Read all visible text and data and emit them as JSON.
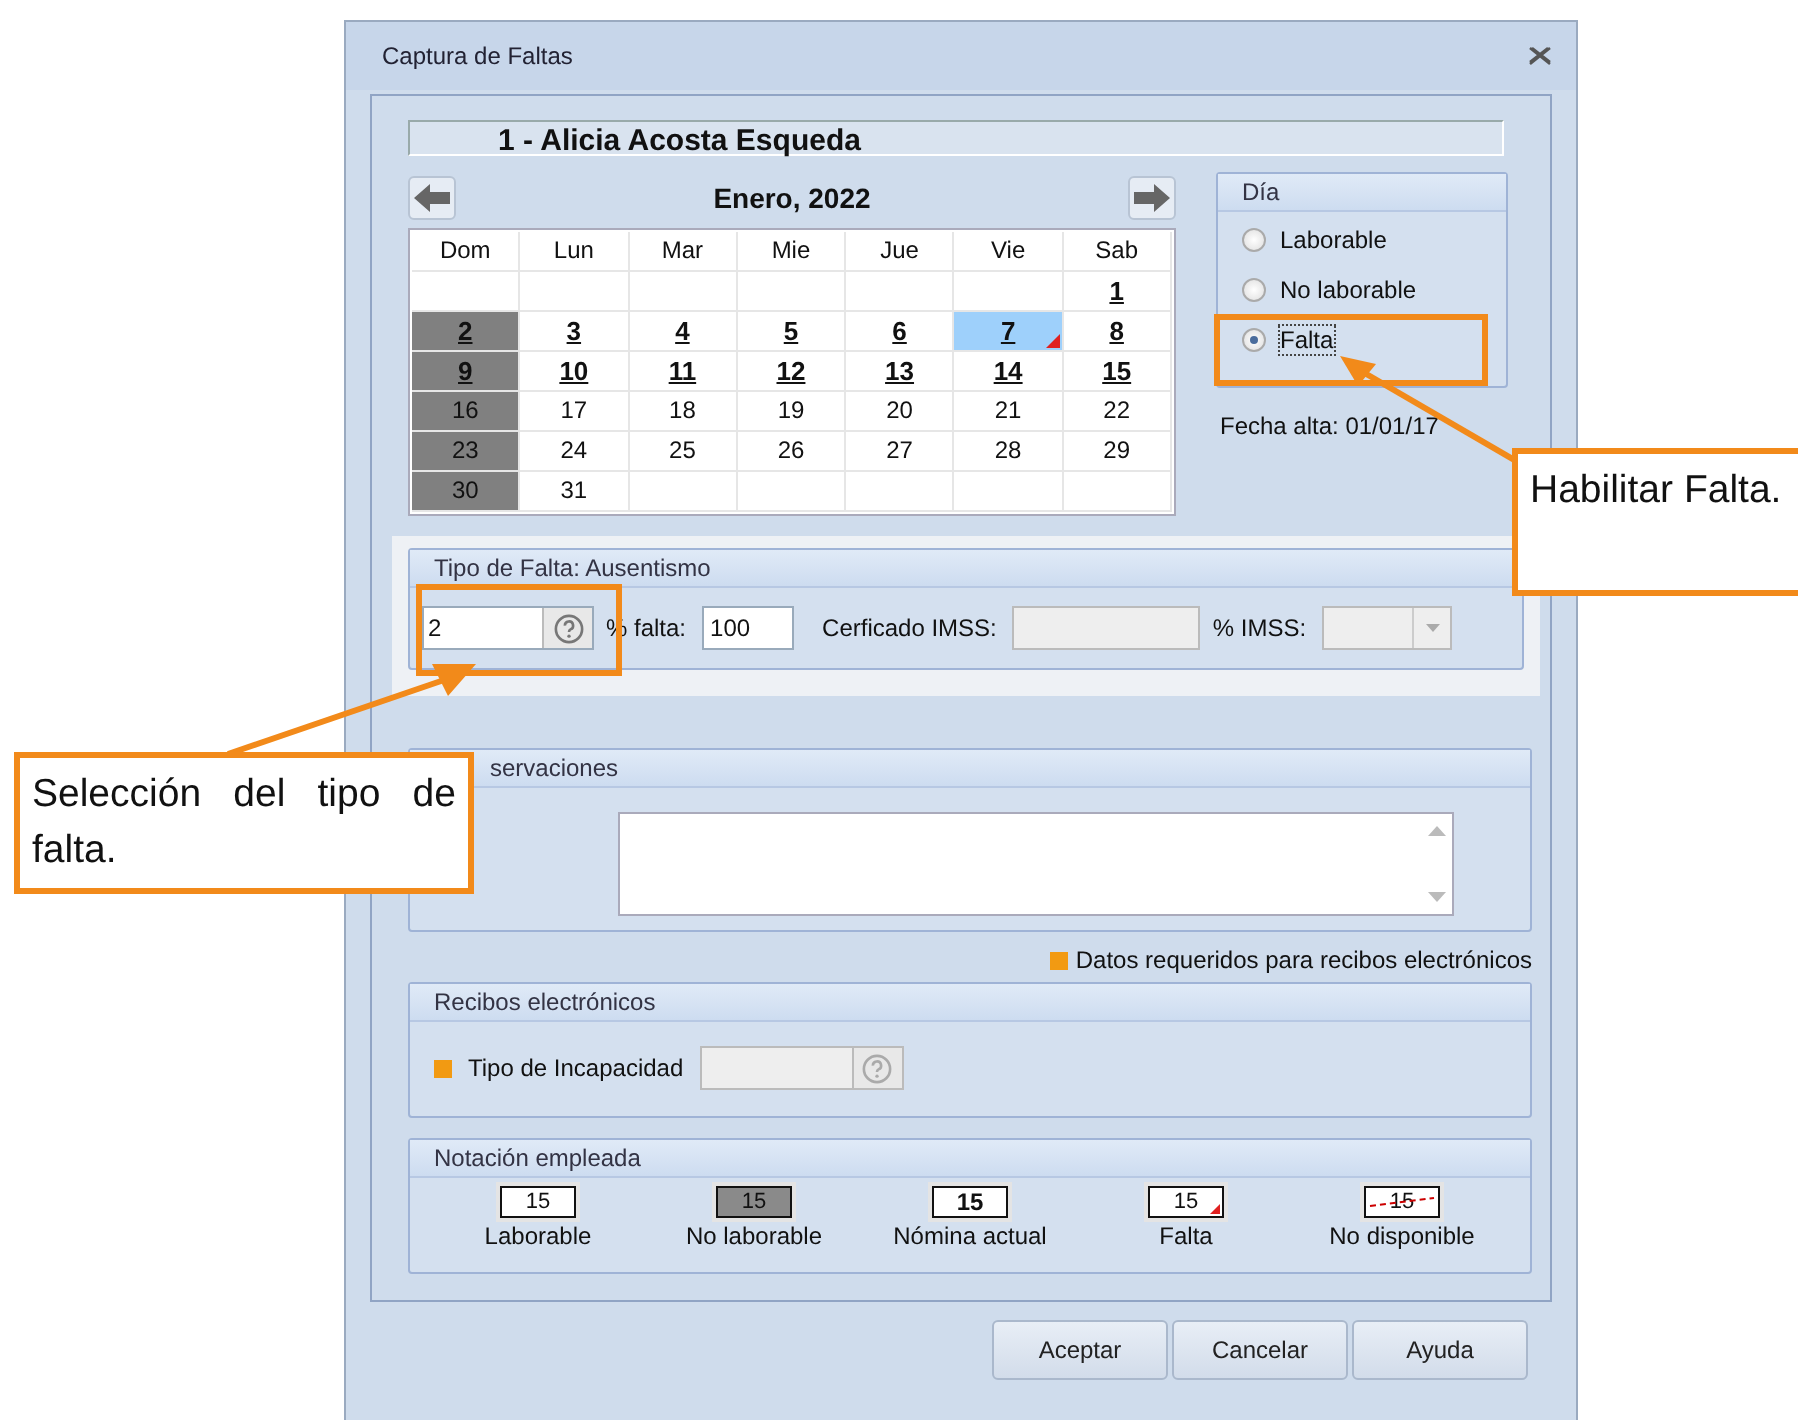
{
  "window": {
    "title": "Captura de Faltas"
  },
  "employee": "1 - Alicia Acosta Esqueda",
  "calendar": {
    "month": "Enero, 2022",
    "weekdays": [
      "Dom",
      "Lun",
      "Mar",
      "Mie",
      "Jue",
      "Vie",
      "Sab"
    ],
    "weeks": [
      [
        {
          "day": "1",
          "nonworking": false,
          "payroll": true,
          "selected": false,
          "falta": false
        }
      ],
      [
        {
          "day": "2",
          "nonworking": true,
          "payroll": true,
          "selected": false,
          "falta": false
        },
        {
          "day": "3",
          "nonworking": false,
          "payroll": true,
          "selected": false,
          "falta": false
        },
        {
          "day": "4",
          "nonworking": false,
          "payroll": true,
          "selected": false,
          "falta": false
        },
        {
          "day": "5",
          "nonworking": false,
          "payroll": true,
          "selected": false,
          "falta": false
        },
        {
          "day": "6",
          "nonworking": false,
          "payroll": true,
          "selected": false,
          "falta": false
        },
        {
          "day": "7",
          "nonworking": false,
          "payroll": true,
          "selected": true,
          "falta": true
        },
        {
          "day": "8",
          "nonworking": false,
          "payroll": true,
          "selected": false,
          "falta": false
        }
      ],
      [
        {
          "day": "9",
          "nonworking": true,
          "payroll": true,
          "selected": false,
          "falta": false
        },
        {
          "day": "10",
          "nonworking": false,
          "payroll": true,
          "selected": false,
          "falta": false
        },
        {
          "day": "11",
          "nonworking": false,
          "payroll": true,
          "selected": false,
          "falta": false
        },
        {
          "day": "12",
          "nonworking": false,
          "payroll": true,
          "selected": false,
          "falta": false
        },
        {
          "day": "13",
          "nonworking": false,
          "payroll": true,
          "selected": false,
          "falta": false
        },
        {
          "day": "14",
          "nonworking": false,
          "payroll": true,
          "selected": false,
          "falta": false
        },
        {
          "day": "15",
          "nonworking": false,
          "payroll": true,
          "selected": false,
          "falta": false
        }
      ],
      [
        {
          "day": "16",
          "nonworking": true,
          "payroll": false,
          "selected": false,
          "falta": false
        },
        {
          "day": "17",
          "nonworking": false,
          "payroll": false,
          "selected": false,
          "falta": false
        },
        {
          "day": "18",
          "nonworking": false,
          "payroll": false,
          "selected": false,
          "falta": false
        },
        {
          "day": "19",
          "nonworking": false,
          "payroll": false,
          "selected": false,
          "falta": false
        },
        {
          "day": "20",
          "nonworking": false,
          "payroll": false,
          "selected": false,
          "falta": false
        },
        {
          "day": "21",
          "nonworking": false,
          "payroll": false,
          "selected": false,
          "falta": false
        },
        {
          "day": "22",
          "nonworking": false,
          "payroll": false,
          "selected": false,
          "falta": false
        }
      ],
      [
        {
          "day": "23",
          "nonworking": true,
          "payroll": false,
          "selected": false,
          "falta": false
        },
        {
          "day": "24",
          "nonworking": false,
          "payroll": false,
          "selected": false,
          "falta": false
        },
        {
          "day": "25",
          "nonworking": false,
          "payroll": false,
          "selected": false,
          "falta": false
        },
        {
          "day": "26",
          "nonworking": false,
          "payroll": false,
          "selected": false,
          "falta": false
        },
        {
          "day": "27",
          "nonworking": false,
          "payroll": false,
          "selected": false,
          "falta": false
        },
        {
          "day": "28",
          "nonworking": false,
          "payroll": false,
          "selected": false,
          "falta": false
        },
        {
          "day": "29",
          "nonworking": false,
          "payroll": false,
          "selected": false,
          "falta": false
        }
      ],
      [
        {
          "day": "30",
          "nonworking": true,
          "payroll": false,
          "selected": false,
          "falta": false
        },
        {
          "day": "31",
          "nonworking": false,
          "payroll": false,
          "selected": false,
          "falta": false
        }
      ]
    ]
  },
  "day_type": {
    "title": "Día",
    "options": [
      {
        "label": "Laborable",
        "selected": false
      },
      {
        "label": "No laborable",
        "selected": false
      },
      {
        "label": "Falta",
        "selected": true
      }
    ]
  },
  "fecha_alta": "Fecha alta: 01/01/17",
  "tipo_falta": {
    "title": "Tipo de Falta: Ausentismo",
    "code": "2",
    "pct_label": "% falta:",
    "pct": "100",
    "cert_label": "Cerficado IMSS:",
    "imss_label": "% IMSS:"
  },
  "observaciones": {
    "title": "servaciones"
  },
  "required_note": "Datos requeridos para recibos electrónicos",
  "recibos": {
    "title": "Recibos electrónicos",
    "field_label": "Tipo de Incapacidad"
  },
  "notation": {
    "title": "Notación empleada",
    "items": [
      {
        "kind": "laborable",
        "sample": "15",
        "label": "Laborable"
      },
      {
        "kind": "no_laborable",
        "sample": "15",
        "label": "No laborable"
      },
      {
        "kind": "nomina",
        "sample": "15",
        "label": "Nómina actual"
      },
      {
        "kind": "falta",
        "sample": "15",
        "label": "Falta"
      },
      {
        "kind": "no_disponible",
        "sample": "15",
        "label": "No disponible"
      }
    ]
  },
  "buttons": [
    "Aceptar",
    "Cancelar",
    "Ayuda"
  ],
  "callouts": [
    "Habilitar Falta.",
    "Selección del tipo de falta."
  ]
}
